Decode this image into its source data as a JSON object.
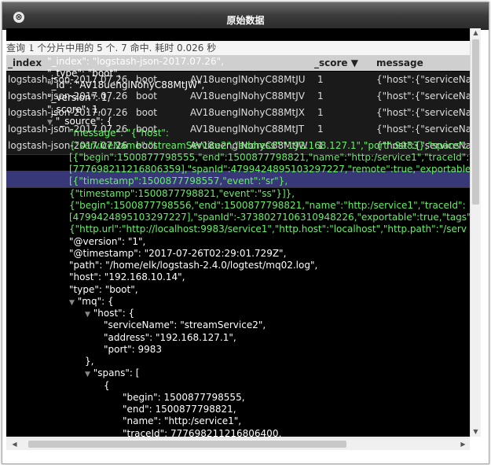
{
  "dialog": {
    "title": "原始数据",
    "close_icon": "⊗"
  },
  "background_table": {
    "status_text": "查询 1 个分片中用的 5 个. 7 命中. 耗时 0.026 秒",
    "columns": [
      "_index",
      "_type",
      "_id",
      "_score ▼",
      "message"
    ],
    "rows": [
      [
        "logstash-json-2017.07.26",
        "boot",
        "AV18uenglNohyC88MtJU",
        "1",
        "{\"host\":{\"serviceNa"
      ],
      [
        "logstash-json-2017.07.26",
        "boot",
        "AV18uenglNohyC88MtJV",
        "1",
        "{\"host\":{\"serviceNa"
      ],
      [
        "logstash-json-2017.07.26",
        "boot",
        "AV18uenglNohyC88MtJX",
        "1",
        "{\"host\":{\"serviceNa"
      ],
      [
        "logstash-json-2017.07.26",
        "boot",
        "AV18uenglNohyC88MtJT",
        "1",
        "{\"host\":{\"serviceNa"
      ],
      [
        "logstash-json-2017.07.26",
        "boot",
        "AV18uenglNohyC88MtJW",
        "1",
        "{\"host\":{\"serviceNa"
      ]
    ]
  },
  "json_view": {
    "lines": [
      "{",
      "\"_index\": \"logstash-json-2017.07.26\",",
      "\"_type\": \"boot\",",
      "\"_id\": \"AV18uenglNohyC88MtJW\",",
      "\"_version\": 1,",
      "\"_score\": 1,",
      "\"_source\": {",
      "\"message\": \"{\"host\":",
      "{\"serviceName\":\"streamService2\",\"address\":\"192.168.127.1\",\"port\":9983},\"spans\":",
      "[{\"begin\":1500877798555,\"end\":1500877798821,\"name\":\"http:/service1\",\"traceId\":",
      "[777698211216806359],\"spanId\":4799424895103297227,\"remote\":true,\"exportable\":",
      "[{\"timestamp\":1500877798557,\"event\":\"sr\"},",
      "{\"timestamp\":1500877798821,\"event\":\"ss\"}]},",
      "{\"begin\":1500877798556,\"end\":1500877798821,\"name\":\"http:/service1\",\"traceId\":",
      "[4799424895103297227],\"spanId\":-3738027106310948226,\"exportable\":true,\"tags\"",
      "{\"http.url\":\"http://localhost:9983/service1\",\"http.host\":\"localhost\",\"http.path\":\"/serv",
      "\"@version\": \"1\",",
      "\"@timestamp\": \"2017-07-26T02:29:01.729Z\",",
      "\"path\": \"/home/elk/logstash-2.4.0/logtest/mq02.log\",",
      "\"host\": \"192.168.10.14\",",
      "\"type\": \"boot\",",
      "\"mq\": {",
      "\"host\": {",
      "\"serviceName\": \"streamService2\",",
      "\"address\": \"192.168.127.1\",",
      "\"port\": 9983",
      "},",
      "\"spans\": [",
      "{",
      "\"begin\": 1500877798555,",
      "\"end\": 1500877798821,",
      "\"name\": \"http:/service1\",",
      "\"traceId\": 777698211216806400,"
    ]
  }
}
